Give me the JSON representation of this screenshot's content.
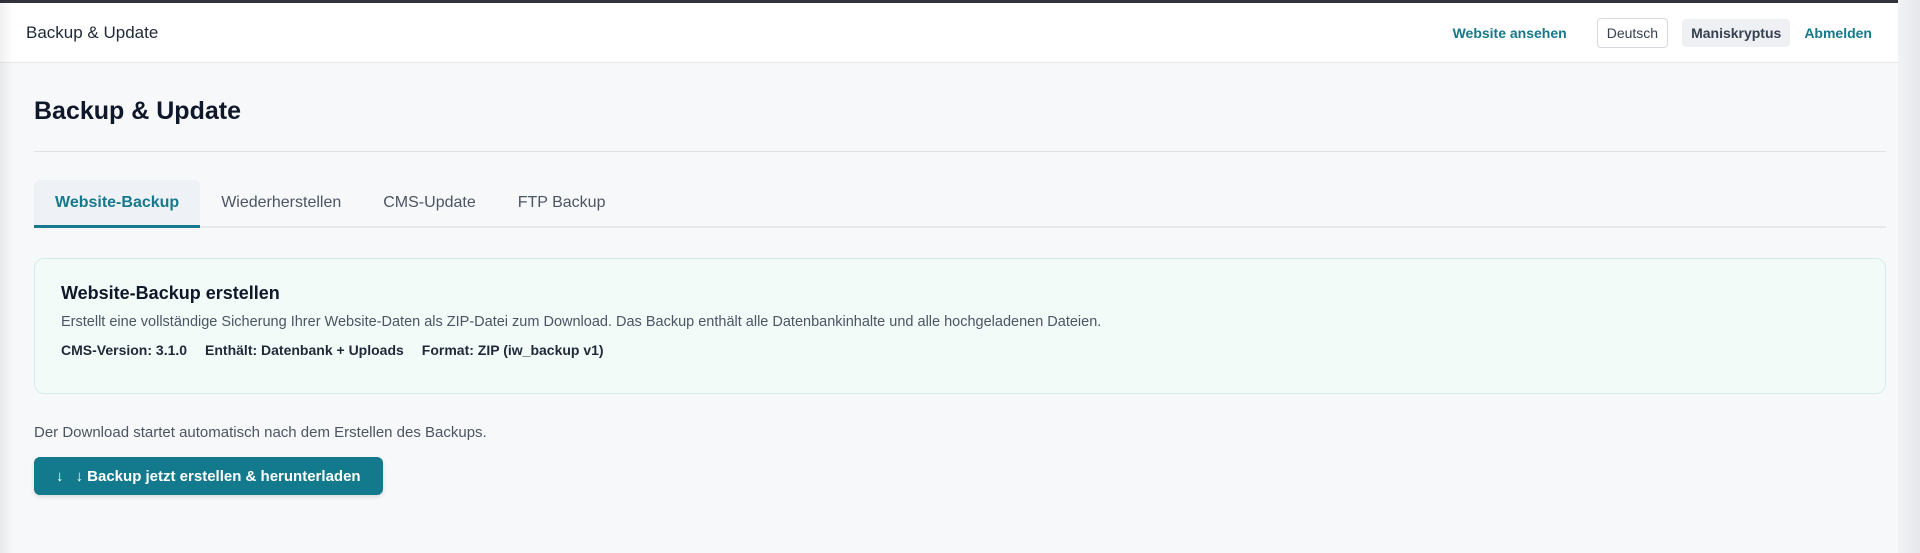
{
  "header": {
    "title": "Backup & Update",
    "view_site": "Website ansehen",
    "language": "Deutsch",
    "user": "Maniskryptus",
    "logout": "Abmelden"
  },
  "page": {
    "title": "Backup & Update"
  },
  "tabs": [
    {
      "label": "Website-Backup",
      "active": true
    },
    {
      "label": "Wiederherstellen",
      "active": false
    },
    {
      "label": "CMS-Update",
      "active": false
    },
    {
      "label": "FTP Backup",
      "active": false
    }
  ],
  "backup_card": {
    "title": "Website-Backup erstellen",
    "description": "Erstellt eine vollständige Sicherung Ihrer Website-Daten als ZIP-Datei zum Download. Das Backup enthält alle Datenbankinhalte und alle hochgeladenen Dateien.",
    "cms_version": "CMS-Version: 3.1.0",
    "contains": "Enthält: Datenbank + Uploads",
    "format": "Format: ZIP (iw_backup v1)"
  },
  "note": "Der Download startet automatisch nach dem Erstellen des Backups.",
  "action": {
    "icon": "download-arrow-icon",
    "icon_glyph": "↓",
    "label": "↓ Backup jetzt erstellen & herunterladen"
  },
  "colors": {
    "accent": "#137a8d",
    "link": "#16788b",
    "card_bg": "#f3fbf9",
    "page_bg": "#f7f8fa"
  }
}
